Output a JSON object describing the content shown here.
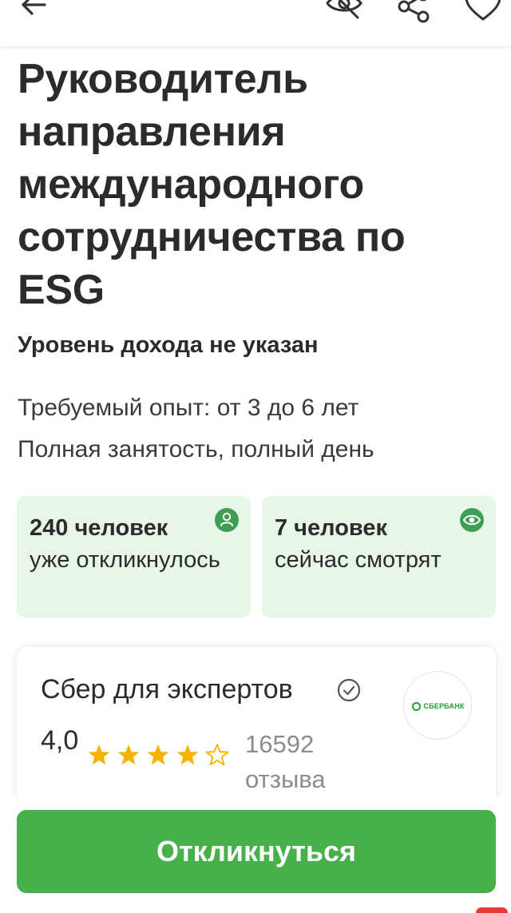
{
  "topbar": {
    "back_icon": "arrow-left-icon",
    "hide_icon": "eye-off-icon",
    "share_icon": "share-icon",
    "favorite_icon": "heart-outline-icon"
  },
  "vacancy": {
    "title": "Руководитель направления международного сотрудничества по ESG",
    "salary": "Уровень дохода не указан",
    "experience": "Требуемый опыт: от 3 до 6 лет",
    "employment": "Полная занятость, полный день"
  },
  "stats": [
    {
      "count": "240 человек",
      "text": "уже откликнулось",
      "icon": "person-icon"
    },
    {
      "count": "7 человек",
      "text": "сейчас смотрят",
      "icon": "eye-icon"
    }
  ],
  "company": {
    "name": "Сбер для экспертов",
    "verified_icon": "check-circle-icon",
    "logo_text": "СБЕРБАНК",
    "rating": "4,0",
    "stars_filled": 4,
    "stars_total": 5,
    "reviews": "16592 отзыва"
  },
  "actions": {
    "apply_label": "Откликнуться"
  },
  "colors": {
    "accent_green": "#48b04b",
    "card_green_bg": "#e7f6e7",
    "icon_green": "#3f9e54",
    "star_yellow": "#f5b301",
    "text_dark": "#2b2b2b",
    "text_muted": "#8c8c8c"
  }
}
